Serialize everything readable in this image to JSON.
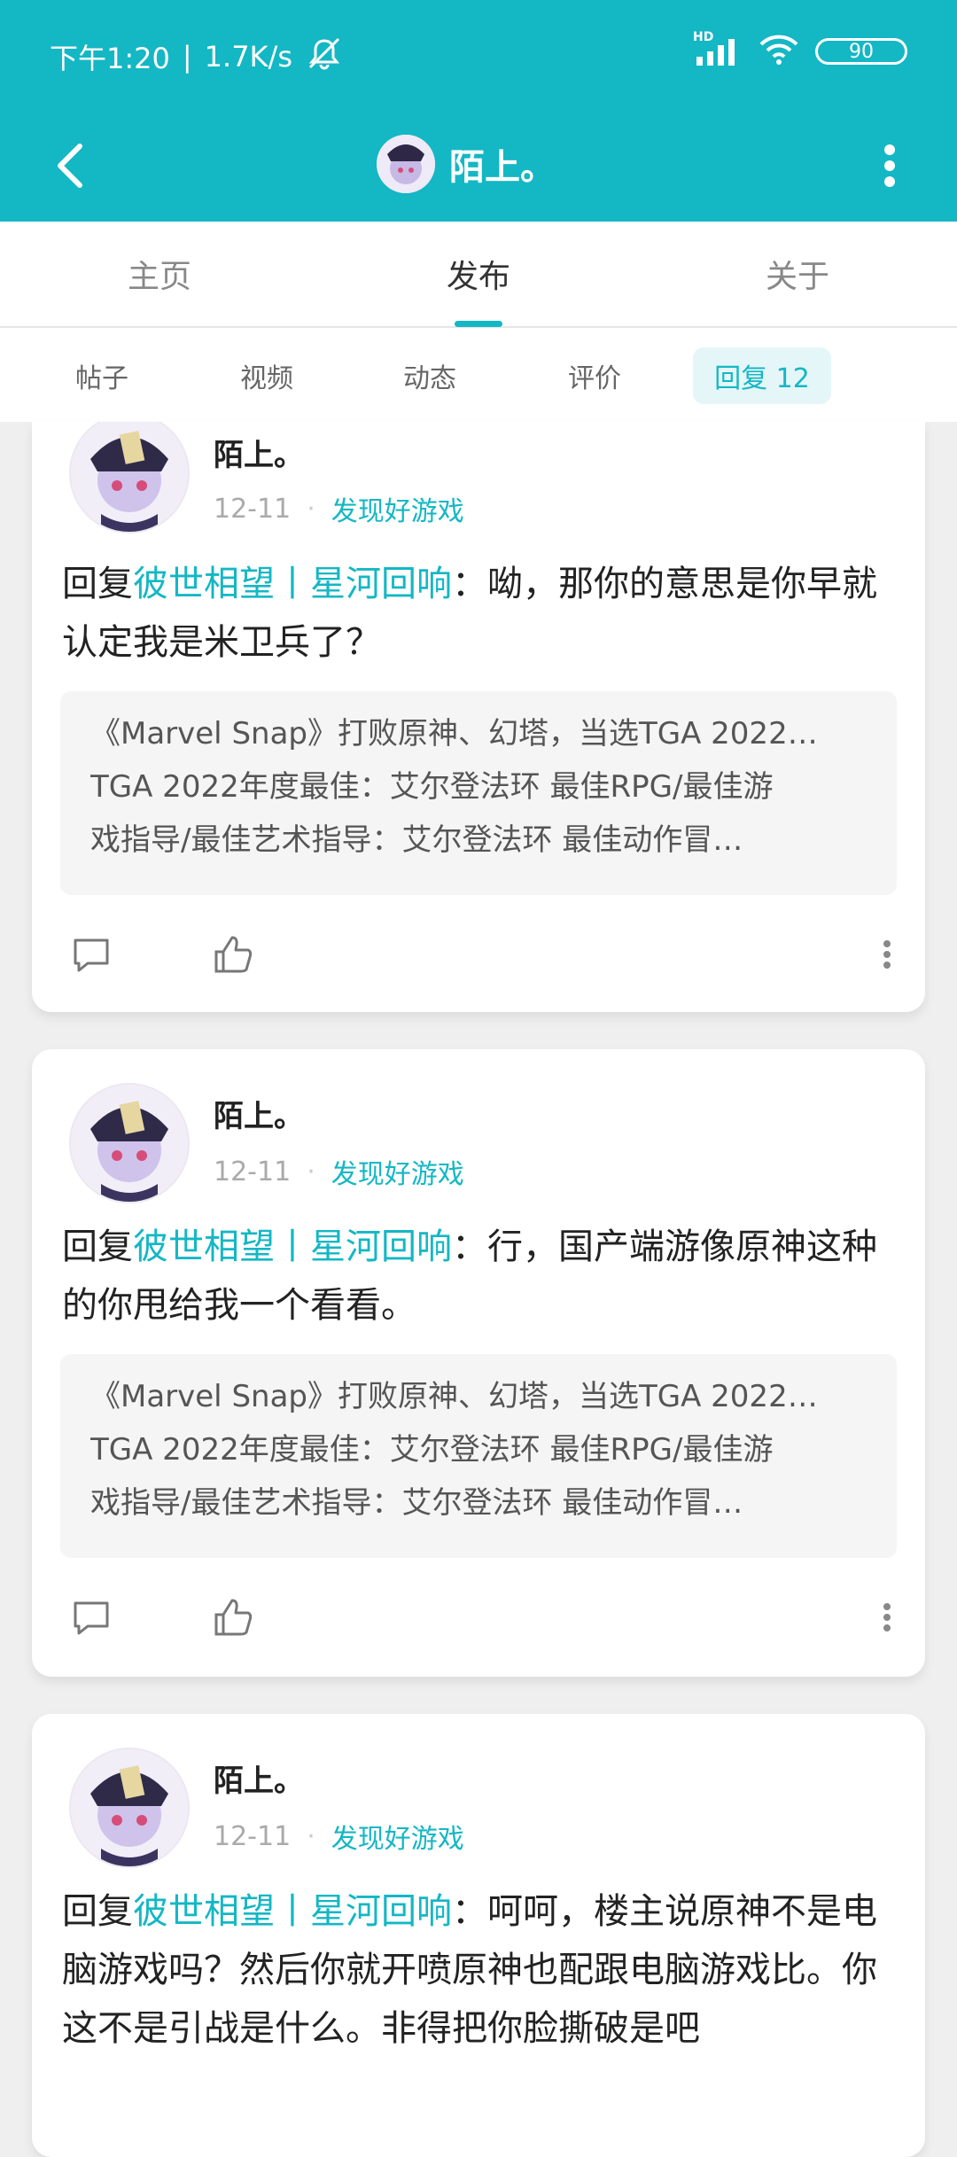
{
  "status": {
    "time": "下午1:20",
    "separator": "|",
    "speed": "1.7K/s",
    "battery": "90",
    "net_label": "HD"
  },
  "header": {
    "title": "陌上。"
  },
  "tabs": [
    {
      "label": "主页"
    },
    {
      "label": "发布"
    },
    {
      "label": "关于"
    }
  ],
  "subtabs": [
    {
      "label": "帖子"
    },
    {
      "label": "视频"
    },
    {
      "label": "动态"
    },
    {
      "label": "评价"
    },
    {
      "label": "回复 12"
    }
  ],
  "posts": [
    {
      "user": "陌上。",
      "date": "12-11",
      "dot": "·",
      "game": "发现好游戏",
      "reply_prefix": "回复",
      "reply_target": "彼世相望丨星河回响",
      "reply_text": "：呦，那你的意思是你早就认定我是米卫兵了？",
      "quote": [
        "《Marvel Snap》打败原神、幻塔，当选TGA 2022…",
        "TGA 2022年度最佳：艾尔登法环 最佳RPG/最佳游",
        "戏指导/最佳艺术指导：艾尔登法环 最佳动作冒…"
      ]
    },
    {
      "user": "陌上。",
      "date": "12-11",
      "dot": "·",
      "game": "发现好游戏",
      "reply_prefix": "回复",
      "reply_target": "彼世相望丨星河回响",
      "reply_text": "：行，国产端游像原神这种的你甩给我一个看看。",
      "quote": [
        "《Marvel Snap》打败原神、幻塔，当选TGA 2022…",
        "TGA 2022年度最佳：艾尔登法环 最佳RPG/最佳游",
        "戏指导/最佳艺术指导：艾尔登法环 最佳动作冒…"
      ]
    },
    {
      "user": "陌上。",
      "date": "12-11",
      "dot": "·",
      "game": "发现好游戏",
      "reply_prefix": "回复",
      "reply_target": "彼世相望丨星河回响",
      "reply_text": "：呵呵，楼主说原神不是电脑游戏吗？然后你就开喷原神也配跟电脑游戏比。你这不是引战是什么。非得把你脸撕破是吧"
    }
  ],
  "colors": {
    "accent": "#14b7c4",
    "page_bg": "#efefef"
  }
}
